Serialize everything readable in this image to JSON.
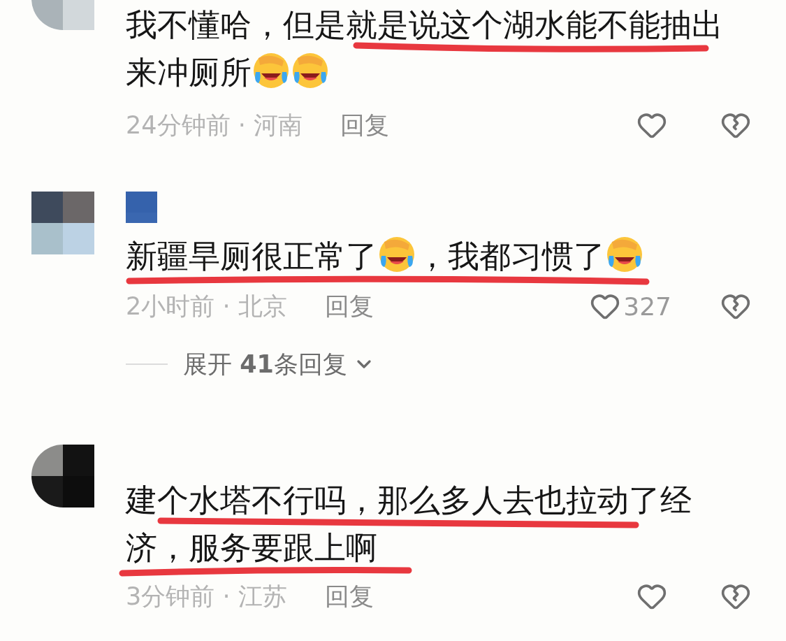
{
  "comments": [
    {
      "segments": [
        {
          "kind": "text",
          "text": "我不懂哈，但是就是说这个湖水能不能抽出来冲厕所"
        },
        {
          "kind": "emoji"
        },
        {
          "kind": "emoji"
        }
      ],
      "time": "24分钟前 · 河南",
      "reply": "回复"
    },
    {
      "segments": [
        {
          "kind": "text",
          "text": "新疆旱厕很正常了"
        },
        {
          "kind": "emoji"
        },
        {
          "kind": "text",
          "text": "，我都习惯了"
        },
        {
          "kind": "emoji"
        }
      ],
      "time": "2小时前 · 北京",
      "reply": "回复",
      "likes": "327",
      "expand": "展开 **41**条回复"
    },
    {
      "segments": [
        {
          "kind": "text",
          "text": "建个水塔不行吗，那么多人去也拉动了经济，服务要跟上啊"
        }
      ],
      "time": "3分钟前 · 江苏",
      "reply": "回复"
    }
  ]
}
